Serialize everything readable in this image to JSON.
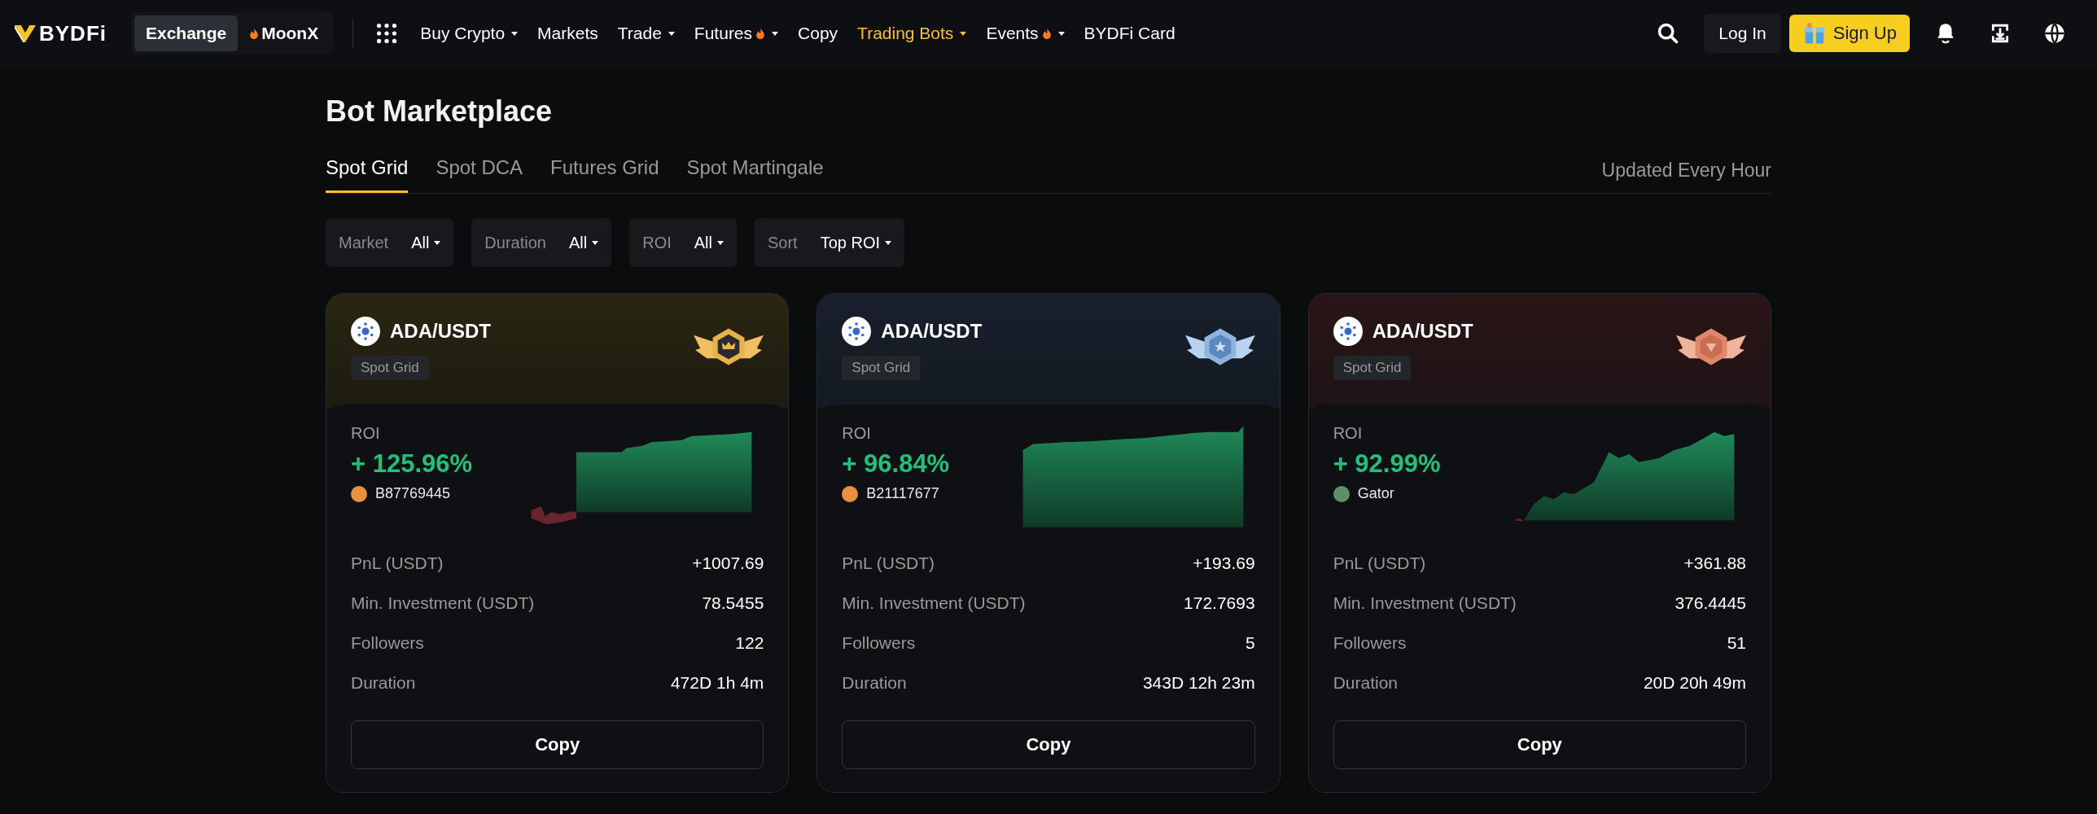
{
  "nav": {
    "logo": "BYDFi",
    "switch": [
      {
        "label": "Exchange",
        "selected": true,
        "hot": false
      },
      {
        "label": "MoonX",
        "selected": false,
        "hot": true
      }
    ],
    "menu": [
      {
        "label": "Buy Crypto",
        "dropdown": true,
        "hot": false,
        "selected": false
      },
      {
        "label": "Markets",
        "dropdown": false,
        "hot": false,
        "selected": false
      },
      {
        "label": "Trade",
        "dropdown": true,
        "hot": false,
        "selected": false
      },
      {
        "label": "Futures",
        "dropdown": true,
        "hot": true,
        "selected": false
      },
      {
        "label": "Copy",
        "dropdown": false,
        "hot": false,
        "selected": false
      },
      {
        "label": "Trading Bots",
        "dropdown": true,
        "hot": false,
        "selected": true
      },
      {
        "label": "Events",
        "dropdown": true,
        "hot": true,
        "selected": false
      },
      {
        "label": "BYDFi Card",
        "dropdown": false,
        "hot": false,
        "selected": false
      }
    ],
    "login": "Log In",
    "signup": "Sign Up"
  },
  "page": {
    "title": "Bot Marketplace",
    "tabs": [
      {
        "label": "Spot Grid",
        "selected": true
      },
      {
        "label": "Spot DCA",
        "selected": false
      },
      {
        "label": "Futures Grid",
        "selected": false
      },
      {
        "label": "Spot Martingale",
        "selected": false
      }
    ],
    "updated": "Updated Every Hour",
    "filters": [
      {
        "label": "Market",
        "value": "All"
      },
      {
        "label": "Duration",
        "value": "All"
      },
      {
        "label": "ROI",
        "value": "All"
      },
      {
        "label": "Sort",
        "value": "Top ROI"
      }
    ]
  },
  "cards": [
    {
      "pair": "ADA/USDT",
      "type": "Spot Grid",
      "kind": "gold",
      "roi_label": "ROI",
      "roi": "+ 125.96%",
      "trader": {
        "name": "B87769445",
        "color": "#e8913a"
      },
      "stats": [
        {
          "label": "PnL (USDT)",
          "value": "+1007.69"
        },
        {
          "label": "Min. Investment (USDT)",
          "value": "78.5455"
        },
        {
          "label": "Followers",
          "value": "122"
        },
        {
          "label": "Duration",
          "value": "472D 1h 4m"
        }
      ],
      "button": "Copy"
    },
    {
      "pair": "ADA/USDT",
      "type": "Spot Grid",
      "kind": "silver",
      "roi_label": "ROI",
      "roi": "+ 96.84%",
      "trader": {
        "name": "B21117677",
        "color": "#e8913a"
      },
      "stats": [
        {
          "label": "PnL (USDT)",
          "value": "+193.69"
        },
        {
          "label": "Min. Investment (USDT)",
          "value": "172.7693"
        },
        {
          "label": "Followers",
          "value": "5"
        },
        {
          "label": "Duration",
          "value": "343D 12h 23m"
        }
      ],
      "button": "Copy"
    },
    {
      "pair": "ADA/USDT",
      "type": "Spot Grid",
      "kind": "bronze",
      "roi_label": "ROI",
      "roi": "+ 92.99%",
      "trader": {
        "name": "Gator",
        "color": "#5f8f6a"
      },
      "stats": [
        {
          "label": "PnL (USDT)",
          "value": "+361.88"
        },
        {
          "label": "Min. Investment (USDT)",
          "value": "376.4445"
        },
        {
          "label": "Followers",
          "value": "51"
        },
        {
          "label": "Duration",
          "value": "20D 20h 49m"
        }
      ],
      "button": "Copy"
    }
  ]
}
